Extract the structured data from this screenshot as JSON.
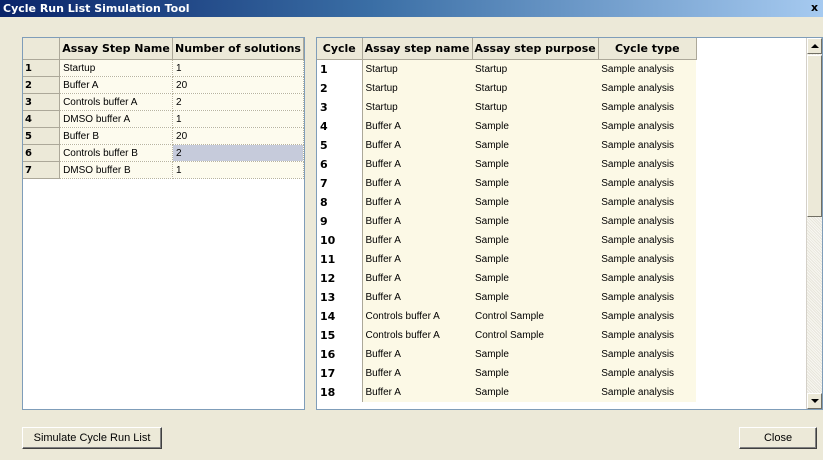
{
  "window": {
    "title": "Cycle Run List Simulation Tool"
  },
  "left_table": {
    "headers": [
      "Assay Step Name",
      "Number of solutions"
    ],
    "rows": [
      {
        "num": "1",
        "name": "Startup",
        "solutions": "1"
      },
      {
        "num": "2",
        "name": "Buffer A",
        "solutions": "20"
      },
      {
        "num": "3",
        "name": "Controls buffer A",
        "solutions": "2"
      },
      {
        "num": "4",
        "name": "DMSO buffer A",
        "solutions": "1"
      },
      {
        "num": "5",
        "name": "Buffer B",
        "solutions": "20"
      },
      {
        "num": "6",
        "name": "Controls buffer B",
        "solutions": "2",
        "selected": true
      },
      {
        "num": "7",
        "name": "DMSO buffer B",
        "solutions": "1"
      }
    ]
  },
  "right_table": {
    "headers": [
      "Cycle",
      "Assay step name",
      "Assay step purpose",
      "Cycle type"
    ],
    "rows": [
      [
        "1",
        "Startup",
        "Startup",
        "Sample analysis"
      ],
      [
        "2",
        "Startup",
        "Startup",
        "Sample analysis"
      ],
      [
        "3",
        "Startup",
        "Startup",
        "Sample analysis"
      ],
      [
        "4",
        "Buffer A",
        "Sample",
        "Sample analysis"
      ],
      [
        "5",
        "Buffer A",
        "Sample",
        "Sample analysis"
      ],
      [
        "6",
        "Buffer A",
        "Sample",
        "Sample analysis"
      ],
      [
        "7",
        "Buffer A",
        "Sample",
        "Sample analysis"
      ],
      [
        "8",
        "Buffer A",
        "Sample",
        "Sample analysis"
      ],
      [
        "9",
        "Buffer A",
        "Sample",
        "Sample analysis"
      ],
      [
        "10",
        "Buffer A",
        "Sample",
        "Sample analysis"
      ],
      [
        "11",
        "Buffer A",
        "Sample",
        "Sample analysis"
      ],
      [
        "12",
        "Buffer A",
        "Sample",
        "Sample analysis"
      ],
      [
        "13",
        "Buffer A",
        "Sample",
        "Sample analysis"
      ],
      [
        "14",
        "Controls buffer A",
        "Control Sample",
        "Sample analysis"
      ],
      [
        "15",
        "Controls buffer A",
        "Control Sample",
        "Sample analysis"
      ],
      [
        "16",
        "Buffer A",
        "Sample",
        "Sample analysis"
      ],
      [
        "17",
        "Buffer A",
        "Sample",
        "Sample analysis"
      ],
      [
        "18",
        "Buffer A",
        "Sample",
        "Sample analysis"
      ]
    ]
  },
  "buttons": {
    "simulate": "Simulate Cycle Run List",
    "close": "Close"
  },
  "icons": {
    "close": "close-icon",
    "scroll_up": "arrow-up-icon",
    "scroll_down": "arrow-down-icon"
  }
}
